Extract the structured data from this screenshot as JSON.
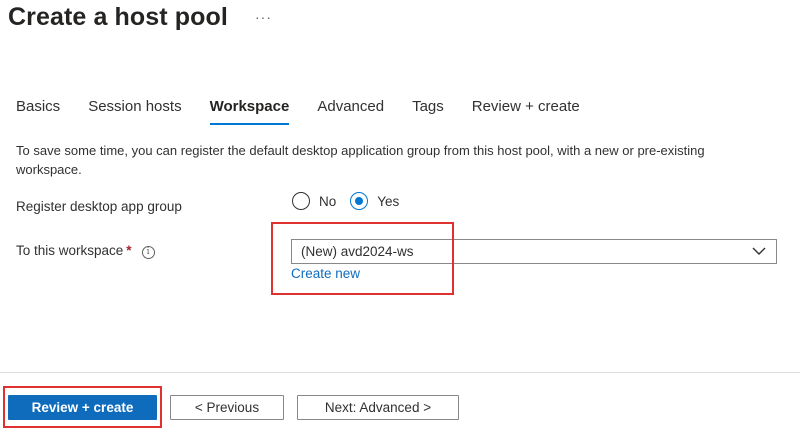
{
  "header": {
    "title": "Create a host pool",
    "more": "···"
  },
  "tabs": [
    {
      "label": "Basics",
      "active": false
    },
    {
      "label": "Session hosts",
      "active": false
    },
    {
      "label": "Workspace",
      "active": true
    },
    {
      "label": "Advanced",
      "active": false
    },
    {
      "label": "Tags",
      "active": false
    },
    {
      "label": "Review + create",
      "active": false
    }
  ],
  "description": "To save some time, you can register the default desktop application group from this host pool, with a new or pre-existing workspace.",
  "register": {
    "label": "Register desktop app group",
    "options": [
      "No",
      "Yes"
    ],
    "selected": "Yes"
  },
  "workspace": {
    "label": "To this workspace",
    "required_mark": "*",
    "info_icon": "info-icon",
    "value": "(New) avd2024-ws",
    "create_new": "Create new"
  },
  "footer": {
    "review_create": "Review + create",
    "previous": "< Previous",
    "next": "Next: Advanced >"
  },
  "colors": {
    "accent": "#0078d4",
    "highlight": "#e03131",
    "link": "#0f6cbd"
  }
}
